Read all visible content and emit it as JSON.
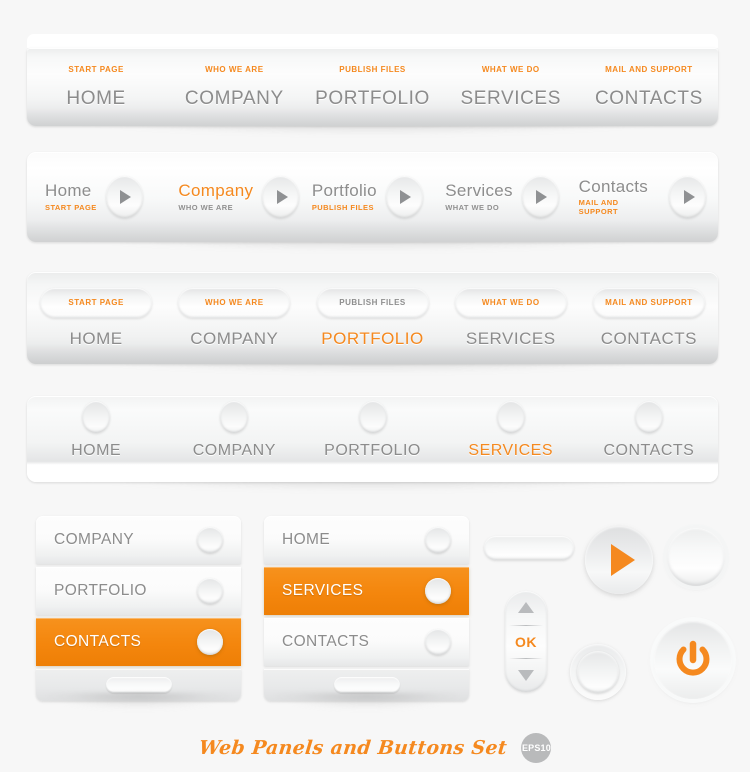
{
  "colors": {
    "accent_orange": "#f5891f",
    "active_bar_orange": "#f4860d",
    "text_gray": "#8c8c8c",
    "panel_light": "#fdfdfd",
    "background": "#f7f7f7",
    "badge_gray": "#b9babb"
  },
  "panel1": {
    "name": "top-nav-panel-with-sublabels",
    "items": [
      {
        "main": "HOME",
        "sub": "START PAGE",
        "sub_color": "orange",
        "active": false
      },
      {
        "main": "COMPANY",
        "sub": "WHO WE ARE",
        "sub_color": "orange",
        "active": false
      },
      {
        "main": "PORTFOLIO",
        "sub": "PUBLISH FILES",
        "sub_color": "orange",
        "active": false
      },
      {
        "main": "SERVICES",
        "sub": "WHAT WE DO",
        "sub_color": "orange",
        "active": false
      },
      {
        "main": "CONTACTS",
        "sub": "MAIL AND SUPPORT",
        "sub_color": "orange",
        "active": false
      }
    ]
  },
  "panel2": {
    "name": "nav-panel-with-arrow-buttons",
    "arrow_icon": "play-triangle-icon",
    "items": [
      {
        "main": "Home",
        "sub": "START PAGE",
        "sub_gray": false,
        "active": false
      },
      {
        "main": "Company",
        "sub": "WHO WE ARE",
        "sub_gray": true,
        "active": true
      },
      {
        "main": "Portfolio",
        "sub": "PUBLISH FILES",
        "sub_gray": false,
        "active": false
      },
      {
        "main": "Services",
        "sub": "WHAT WE DO",
        "sub_gray": true,
        "active": false
      },
      {
        "main": "Contacts",
        "sub": "MAIL AND SUPPORT",
        "sub_gray": false,
        "active": false
      }
    ]
  },
  "panel3": {
    "name": "nav-panel-with-pill-sublabels",
    "items": [
      {
        "main": "HOME",
        "pill": "START PAGE",
        "pill_gray": false,
        "active": false
      },
      {
        "main": "COMPANY",
        "pill": "WHO WE ARE",
        "pill_gray": false,
        "active": false
      },
      {
        "main": "PORTFOLIO",
        "pill": "PUBLISH FILES",
        "pill_gray": true,
        "active": true
      },
      {
        "main": "SERVICES",
        "pill": "WHAT WE DO",
        "pill_gray": false,
        "active": false
      },
      {
        "main": "CONTACTS",
        "pill": "MAIL AND SUPPORT",
        "pill_gray": false,
        "active": false
      }
    ]
  },
  "panel4": {
    "name": "nav-panel-with-radio-circles",
    "items": [
      {
        "main": "HOME",
        "active": false
      },
      {
        "main": "COMPANY",
        "active": false
      },
      {
        "main": "PORTFOLIO",
        "active": false
      },
      {
        "main": "SERVICES",
        "active": true
      },
      {
        "main": "CONTACTS",
        "active": false
      }
    ]
  },
  "vmenu1": {
    "name": "vertical-menu-left",
    "items": [
      {
        "label": "COMPANY",
        "active": false
      },
      {
        "label": "PORTFOLIO",
        "active": false
      },
      {
        "label": "CONTACTS",
        "active": true
      }
    ]
  },
  "vmenu2": {
    "name": "vertical-menu-right",
    "items": [
      {
        "label": "HOME",
        "active": false
      },
      {
        "label": "SERVICES",
        "active": true
      },
      {
        "label": "CONTACTS",
        "active": false
      }
    ]
  },
  "controls": {
    "capsule": {
      "name": "capsule-button",
      "label": ""
    },
    "stepper": {
      "name": "ok-stepper",
      "up_icon": "chevron-up-icon",
      "ok_label": "OK",
      "down_icon": "chevron-down-icon"
    },
    "play": {
      "name": "play-button",
      "icon": "play-triangle-icon"
    },
    "plain": {
      "name": "plain-round-button"
    },
    "ring": {
      "name": "ring-round-button"
    },
    "power": {
      "name": "power-button",
      "icon": "power-icon"
    }
  },
  "footer": {
    "title": "Web Panels and Buttons Set",
    "badge": "EPS10"
  }
}
